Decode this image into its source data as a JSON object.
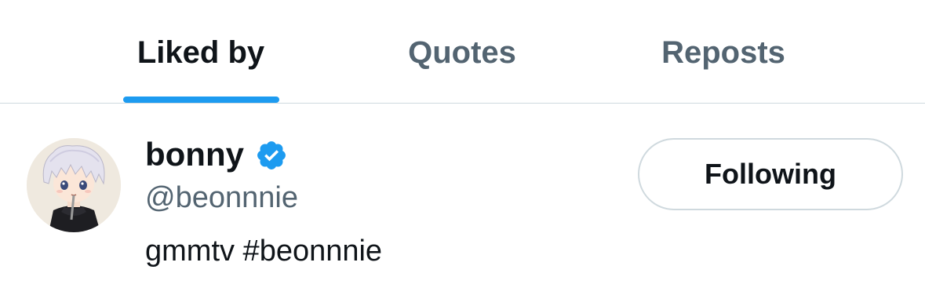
{
  "tabs": [
    {
      "label": "Liked by",
      "active": true
    },
    {
      "label": "Quotes",
      "active": false
    },
    {
      "label": "Reposts",
      "active": false
    }
  ],
  "user": {
    "display_name": "bonny",
    "handle": "@beonnnie",
    "bio": "gmmtv #beonnnie",
    "verified": true,
    "follow_button": "Following"
  },
  "colors": {
    "accent": "#1d9bf0",
    "muted_text": "#536471",
    "text": "#0f1419",
    "border": "#cfd9de"
  },
  "icons": {
    "verified": "verified-badge-icon",
    "avatar": "avatar"
  }
}
